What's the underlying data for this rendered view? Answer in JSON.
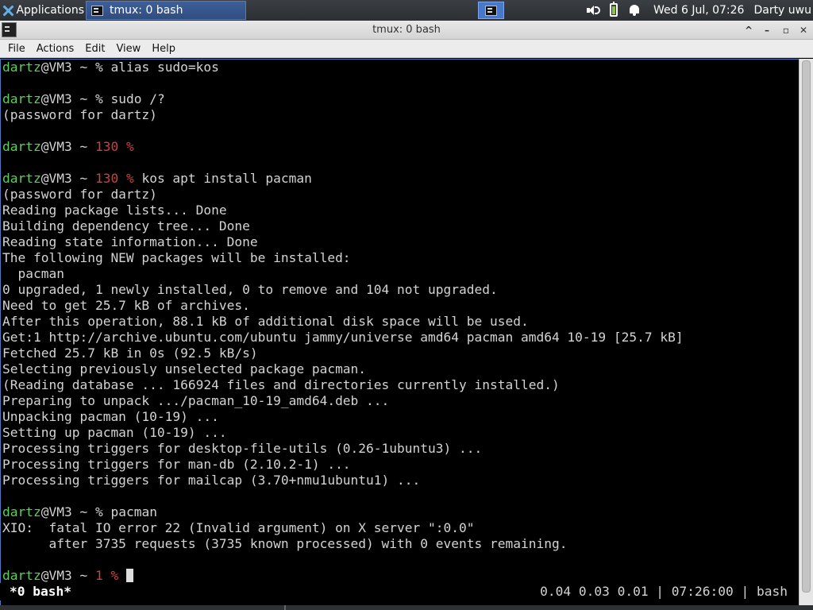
{
  "panel": {
    "apps_label": "Applications",
    "task_label": "tmux: 0 bash",
    "clock": "Wed  6 Jul, 07:26",
    "user": "Darty uwu",
    "icons": [
      "xfce-icon",
      "terminal-icon",
      "volume-icon",
      "battery-icon",
      "bell-icon"
    ]
  },
  "window": {
    "title": "tmux: 0 bash",
    "buttons": [
      "^",
      "–",
      "▫",
      "✕"
    ]
  },
  "menu": {
    "file": "File",
    "actions": "Actions",
    "edit": "Edit",
    "view": "View",
    "help": "Help"
  },
  "terminal": {
    "prompt_user": "dartz",
    "prompt_host": "@VM3 ~ ",
    "lines": [
      {
        "u": "dartz",
        "h": "@VM3 ~ ",
        "code": "",
        "p": "% ",
        "cmd": "alias sudo=kos"
      },
      {
        "t": ""
      },
      {
        "u": "dartz",
        "h": "@VM3 ~ ",
        "code": "",
        "p": "% ",
        "cmd": "sudo /?"
      },
      {
        "t": "(password for dartz)"
      },
      {
        "t": ""
      },
      {
        "u": "dartz",
        "h": "@VM3 ~ ",
        "code": "130 ",
        "p": "%",
        "cmd": ""
      },
      {
        "t": ""
      },
      {
        "u": "dartz",
        "h": "@VM3 ~ ",
        "code": "130 ",
        "p": "% ",
        "cmd": "kos apt install pacman"
      },
      {
        "t": "(password for dartz)"
      },
      {
        "t": "Reading package lists... Done"
      },
      {
        "t": "Building dependency tree... Done"
      },
      {
        "t": "Reading state information... Done"
      },
      {
        "t": "The following NEW packages will be installed:"
      },
      {
        "t": "  pacman"
      },
      {
        "t": "0 upgraded, 1 newly installed, 0 to remove and 104 not upgraded."
      },
      {
        "t": "Need to get 25.7 kB of archives."
      },
      {
        "t": "After this operation, 88.1 kB of additional disk space will be used."
      },
      {
        "t": "Get:1 http://archive.ubuntu.com/ubuntu jammy/universe amd64 pacman amd64 10-19 [25.7 kB]"
      },
      {
        "t": "Fetched 25.7 kB in 0s (92.5 kB/s)"
      },
      {
        "t": "Selecting previously unselected package pacman."
      },
      {
        "t": "(Reading database ... 166924 files and directories currently installed.)"
      },
      {
        "t": "Preparing to unpack .../pacman_10-19_amd64.deb ..."
      },
      {
        "t": "Unpacking pacman (10-19) ..."
      },
      {
        "t": "Setting up pacman (10-19) ..."
      },
      {
        "t": "Processing triggers for desktop-file-utils (0.26-1ubuntu3) ..."
      },
      {
        "t": "Processing triggers for man-db (2.10.2-1) ..."
      },
      {
        "t": "Processing triggers for mailcap (3.70+nmu1ubuntu1) ..."
      },
      {
        "t": ""
      },
      {
        "u": "dartz",
        "h": "@VM3 ~ ",
        "code": "",
        "p": "% ",
        "cmd": "pacman"
      },
      {
        "t": "XIO:  fatal IO error 22 (Invalid argument) on X server \":0.0\""
      },
      {
        "t": "      after 3735 requests (3735 known processed) with 0 events remaining."
      },
      {
        "t": ""
      },
      {
        "u": "dartz",
        "h": "@VM3 ~ ",
        "code": "1 ",
        "p": "% ",
        "cmd": "",
        "cursor": true
      }
    ]
  },
  "tmux": {
    "window": "*0 bash*",
    "status_right": "0.04 0.03 0.01 | 07:26:00 | bash"
  },
  "colors": {
    "prompt_user": "#5ad05a",
    "exit_code": "#d04040",
    "accent": "#4a78c8"
  }
}
